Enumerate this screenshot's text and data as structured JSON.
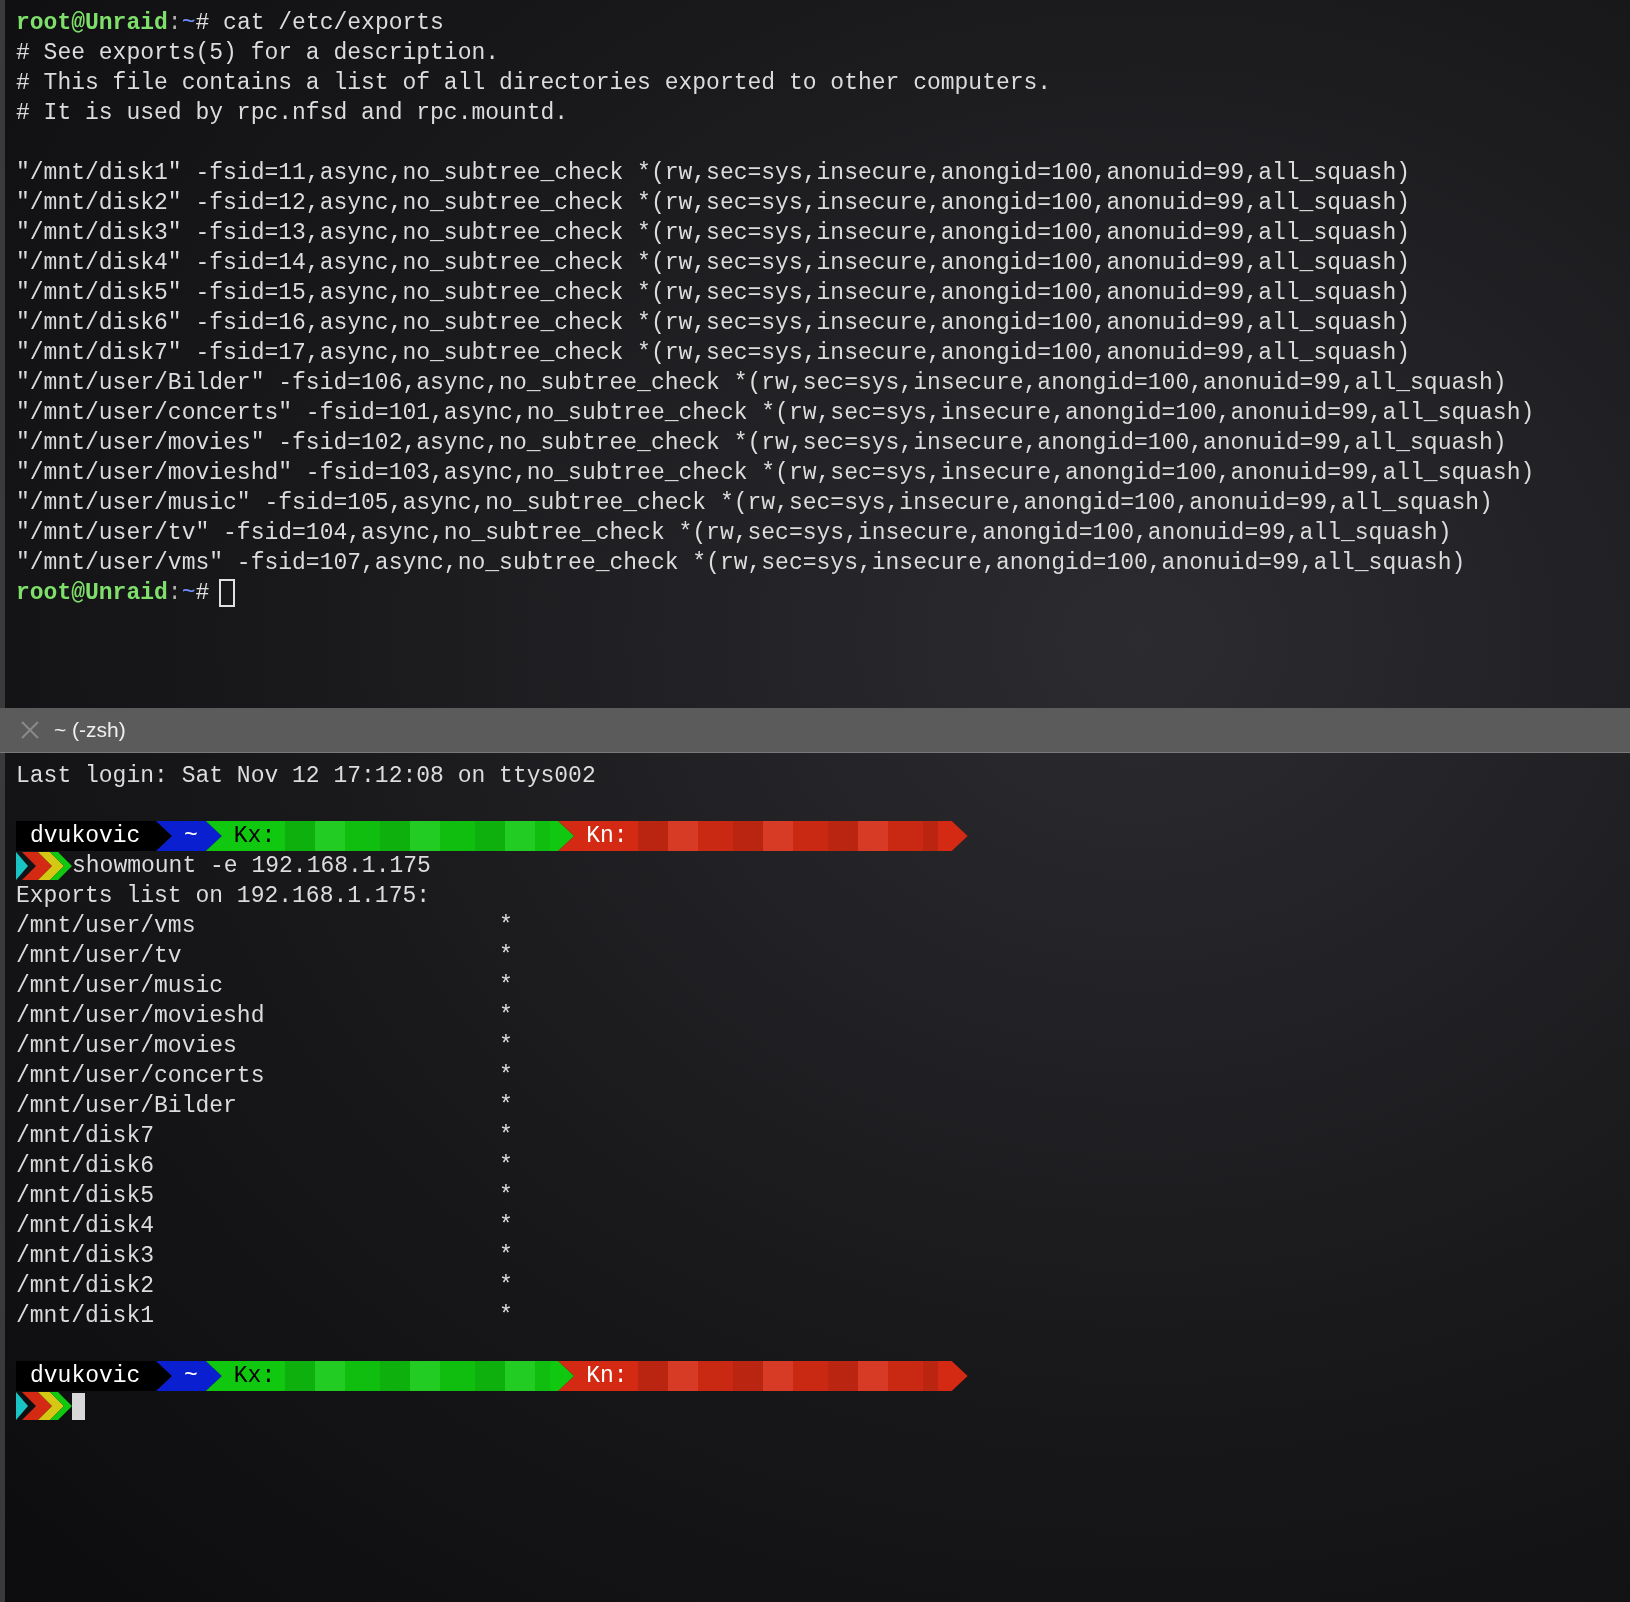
{
  "top_pane": {
    "lines": [
      {
        "kind": "prompt",
        "user": "root@Unraid",
        "separator": ":",
        "path": "~",
        "symbol": "#",
        "command": "cat /etc/exports"
      },
      {
        "kind": "text",
        "text": "# See exports(5) for a description."
      },
      {
        "kind": "text",
        "text": "# This file contains a list of all directories exported to other computers."
      },
      {
        "kind": "text",
        "text": "# It is used by rpc.nfsd and rpc.mountd."
      },
      {
        "kind": "blank"
      },
      {
        "kind": "text",
        "text": "\"/mnt/disk1\" -fsid=11,async,no_subtree_check *(rw,sec=sys,insecure,anongid=100,anonuid=99,all_squash)"
      },
      {
        "kind": "text",
        "text": "\"/mnt/disk2\" -fsid=12,async,no_subtree_check *(rw,sec=sys,insecure,anongid=100,anonuid=99,all_squash)"
      },
      {
        "kind": "text",
        "text": "\"/mnt/disk3\" -fsid=13,async,no_subtree_check *(rw,sec=sys,insecure,anongid=100,anonuid=99,all_squash)"
      },
      {
        "kind": "text",
        "text": "\"/mnt/disk4\" -fsid=14,async,no_subtree_check *(rw,sec=sys,insecure,anongid=100,anonuid=99,all_squash)"
      },
      {
        "kind": "text",
        "text": "\"/mnt/disk5\" -fsid=15,async,no_subtree_check *(rw,sec=sys,insecure,anongid=100,anonuid=99,all_squash)"
      },
      {
        "kind": "text",
        "text": "\"/mnt/disk6\" -fsid=16,async,no_subtree_check *(rw,sec=sys,insecure,anongid=100,anonuid=99,all_squash)"
      },
      {
        "kind": "text",
        "text": "\"/mnt/disk7\" -fsid=17,async,no_subtree_check *(rw,sec=sys,insecure,anongid=100,anonuid=99,all_squash)"
      },
      {
        "kind": "text",
        "text": "\"/mnt/user/Bilder\" -fsid=106,async,no_subtree_check *(rw,sec=sys,insecure,anongid=100,anonuid=99,all_squash)"
      },
      {
        "kind": "text",
        "text": "\"/mnt/user/concerts\" -fsid=101,async,no_subtree_check *(rw,sec=sys,insecure,anongid=100,anonuid=99,all_squash)"
      },
      {
        "kind": "text",
        "text": "\"/mnt/user/movies\" -fsid=102,async,no_subtree_check *(rw,sec=sys,insecure,anongid=100,anonuid=99,all_squash)"
      },
      {
        "kind": "text",
        "text": "\"/mnt/user/movieshd\" -fsid=103,async,no_subtree_check *(rw,sec=sys,insecure,anongid=100,anonuid=99,all_squash)"
      },
      {
        "kind": "text",
        "text": "\"/mnt/user/music\" -fsid=105,async,no_subtree_check *(rw,sec=sys,insecure,anongid=100,anonuid=99,all_squash)"
      },
      {
        "kind": "text",
        "text": "\"/mnt/user/tv\" -fsid=104,async,no_subtree_check *(rw,sec=sys,insecure,anongid=100,anonuid=99,all_squash)"
      },
      {
        "kind": "text",
        "text": "\"/mnt/user/vms\" -fsid=107,async,no_subtree_check *(rw,sec=sys,insecure,anongid=100,anonuid=99,all_squash)"
      },
      {
        "kind": "prompt",
        "user": "root@Unraid",
        "separator": ":",
        "path": "~",
        "symbol": "#",
        "cursor": true
      }
    ]
  },
  "tab": {
    "title": "~ (-zsh)"
  },
  "bottom_pane": {
    "lines": [
      {
        "kind": "text",
        "text": "Last login: Sat Nov 12 17:12:08 on ttys002"
      },
      {
        "kind": "blank"
      },
      {
        "kind": "powerline",
        "segments": [
          {
            "text": "dvukovic",
            "color": "#000000",
            "redacted": false
          },
          {
            "text": "~",
            "color": "#0a1fd0",
            "redacted": false
          },
          {
            "text": "Kx:",
            "color": "#10c810",
            "redacted": true
          },
          {
            "text": "Kn:",
            "color": "#d42a14",
            "redacted": true
          }
        ]
      },
      {
        "kind": "command",
        "command": "showmount -e 192.168.1.175"
      },
      {
        "kind": "text",
        "text": "Exports list on 192.168.1.175:"
      },
      {
        "kind": "export",
        "path": "/mnt/user/vms",
        "clients": "*"
      },
      {
        "kind": "export",
        "path": "/mnt/user/tv",
        "clients": "*"
      },
      {
        "kind": "export",
        "path": "/mnt/user/music",
        "clients": "*"
      },
      {
        "kind": "export",
        "path": "/mnt/user/movieshd",
        "clients": "*"
      },
      {
        "kind": "export",
        "path": "/mnt/user/movies",
        "clients": "*"
      },
      {
        "kind": "export",
        "path": "/mnt/user/concerts",
        "clients": "*"
      },
      {
        "kind": "export",
        "path": "/mnt/user/Bilder",
        "clients": "*"
      },
      {
        "kind": "export",
        "path": "/mnt/disk7",
        "clients": "*"
      },
      {
        "kind": "export",
        "path": "/mnt/disk6",
        "clients": "*"
      },
      {
        "kind": "export",
        "path": "/mnt/disk5",
        "clients": "*"
      },
      {
        "kind": "export",
        "path": "/mnt/disk4",
        "clients": "*"
      },
      {
        "kind": "export",
        "path": "/mnt/disk3",
        "clients": "*"
      },
      {
        "kind": "export",
        "path": "/mnt/disk2",
        "clients": "*"
      },
      {
        "kind": "export",
        "path": "/mnt/disk1",
        "clients": "*"
      },
      {
        "kind": "blank"
      },
      {
        "kind": "powerline",
        "segments": [
          {
            "text": "dvukovic",
            "color": "#000000",
            "redacted": false
          },
          {
            "text": "~",
            "color": "#0a1fd0",
            "redacted": false
          },
          {
            "text": "Kx:",
            "color": "#10c810",
            "redacted": true
          },
          {
            "text": "Kn:",
            "color": "#d42a14",
            "redacted": true
          }
        ]
      },
      {
        "kind": "command",
        "cursor": true
      }
    ]
  }
}
